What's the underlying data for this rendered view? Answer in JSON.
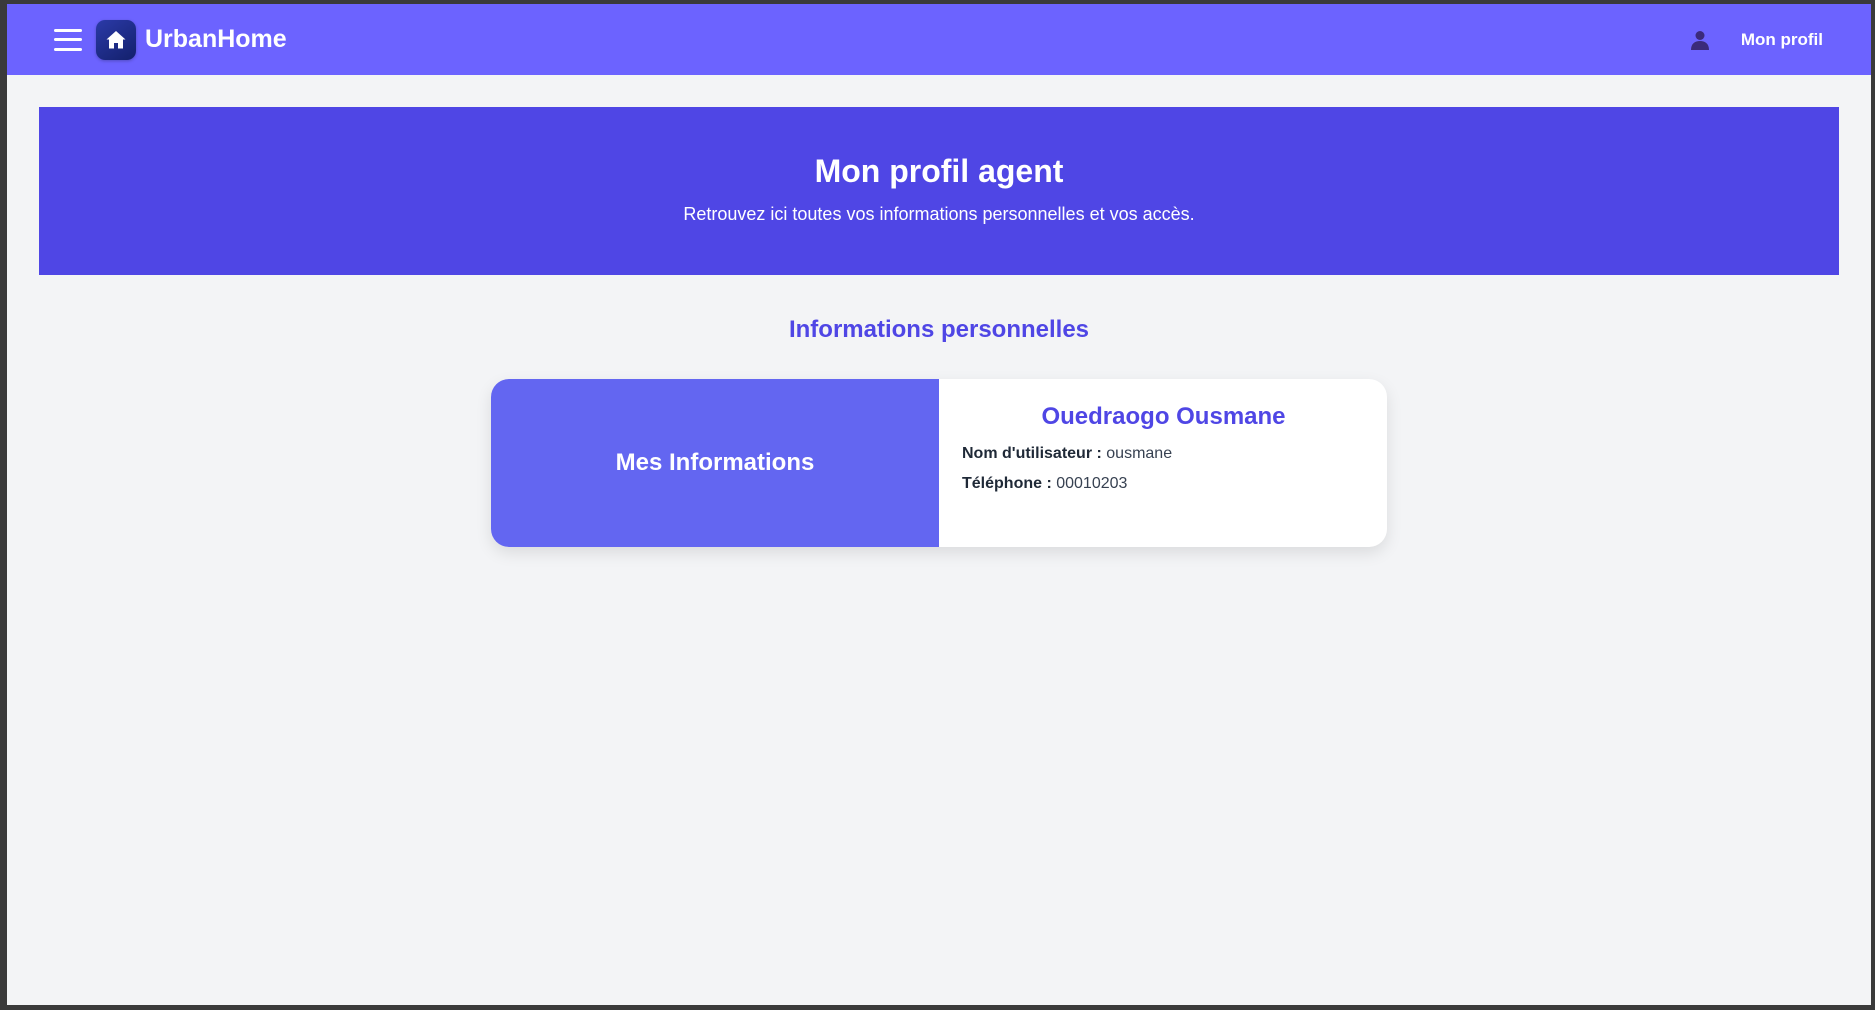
{
  "topbar": {
    "brand": "UrbanHome",
    "profile_label": "Mon profil"
  },
  "hero": {
    "title": "Mon profil agent",
    "subtitle": "Retrouvez ici toutes vos informations personnelles et vos accès."
  },
  "section": {
    "title": "Informations personnelles"
  },
  "card": {
    "left_title": "Mes Informations",
    "name": "Ouedraogo Ousmane",
    "username_label": "Nom d'utilisateur :",
    "username_value": "ousmane",
    "phone_label": "Téléphone :",
    "phone_value": "00010203"
  },
  "colors": {
    "topbar": "#6c63ff",
    "hero": "#4f46e5",
    "card_accent": "#6366f1",
    "title_text": "#4f46e5",
    "page_bg": "#f3f4f6"
  },
  "icons": {
    "menu": "hamburger-menu-icon",
    "logo": "home-icon",
    "profile": "user-icon"
  }
}
